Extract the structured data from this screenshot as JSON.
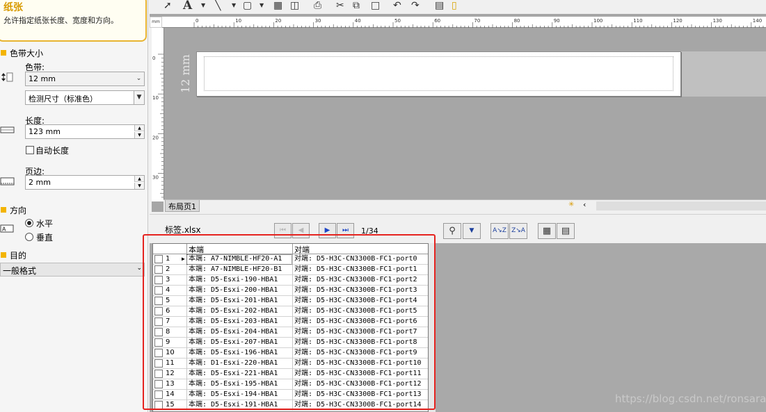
{
  "tip": {
    "title": "纸张",
    "text": "允许指定纸张长度、宽度和方向。"
  },
  "tape_section": {
    "title": "色带大小",
    "tape_label": "色带:",
    "tape_value": "12 mm",
    "detect_value": "检测尺寸（标准色）",
    "length_label": "长度:",
    "length_value": "123 mm",
    "auto_length_label": "自动长度",
    "auto_length_checked": false,
    "margin_label": "页边:",
    "margin_value": "2 mm"
  },
  "orientation_section": {
    "title": "方向",
    "horizontal_label": "水平",
    "vertical_label": "垂直",
    "selected": "水平"
  },
  "purpose_section": {
    "title": "目的",
    "value": "一般格式"
  },
  "ruler": {
    "unit": "mm",
    "top_ticks": [
      "0",
      "10",
      "20",
      "30",
      "40",
      "50",
      "60",
      "70",
      "80",
      "90",
      "100",
      "110",
      "120",
      "130",
      "140"
    ],
    "left_ticks": [
      "0",
      "10",
      "20",
      "30"
    ]
  },
  "canvas": {
    "tape_size_text": "12 mm",
    "page_tab": "布局页1"
  },
  "database": {
    "file_name": "标签.xlsx",
    "record_indicator": "1/34",
    "columns": [
      "本端",
      "对端"
    ],
    "rows": [
      {
        "n": "1",
        "a": "本端: A7-NIMBLE-HF20-A1",
        "b": "对端: D5-H3C-CN3300B-FC1-port0"
      },
      {
        "n": "2",
        "a": "本端: A7-NIMBLE-HF20-B1",
        "b": "对端: D5-H3C-CN3300B-FC1-port1"
      },
      {
        "n": "3",
        "a": "本端: D5-Esxi-190-HBA1",
        "b": "对端: D5-H3C-CN3300B-FC1-port2"
      },
      {
        "n": "4",
        "a": "本端: D5-Esxi-200-HBA1",
        "b": "对端: D5-H3C-CN3300B-FC1-port3"
      },
      {
        "n": "5",
        "a": "本端: D5-Esxi-201-HBA1",
        "b": "对端: D5-H3C-CN3300B-FC1-port4"
      },
      {
        "n": "6",
        "a": "本端: D5-Esxi-202-HBA1",
        "b": "对端: D5-H3C-CN3300B-FC1-port5"
      },
      {
        "n": "7",
        "a": "本端: D5-Esxi-203-HBA1",
        "b": "对端: D5-H3C-CN3300B-FC1-port6"
      },
      {
        "n": "8",
        "a": "本端: D5-Esxi-204-HBA1",
        "b": "对端: D5-H3C-CN3300B-FC1-port7"
      },
      {
        "n": "9",
        "a": "本端: D5-Esxi-207-HBA1",
        "b": "对端: D5-H3C-CN3300B-FC1-port8"
      },
      {
        "n": "10",
        "a": "本端: D5-Esxi-196-HBA1",
        "b": "对端: D5-H3C-CN3300B-FC1-port9"
      },
      {
        "n": "11",
        "a": "本端: D1-Esxi-220-HBA1",
        "b": "对端: D5-H3C-CN3300B-FC1-port10"
      },
      {
        "n": "12",
        "a": "本端: D5-Esxi-221-HBA1",
        "b": "对端: D5-H3C-CN3300B-FC1-port11"
      },
      {
        "n": "13",
        "a": "本端: D5-Esxi-195-HBA1",
        "b": "对端: D5-H3C-CN3300B-FC1-port12"
      },
      {
        "n": "14",
        "a": "本端: D5-Esxi-194-HBA1",
        "b": "对端: D5-H3C-CN3300B-FC1-port13"
      },
      {
        "n": "15",
        "a": "本端: D5-Esxi-191-HBA1",
        "b": "对端: D5-H3C-CN3300B-FC1-port14"
      }
    ],
    "selected_row": "1"
  },
  "watermark": "https://blog.csdn.net/ronsarah",
  "colors": {
    "accent": "#f3b400",
    "highlight_box": "#e5231f"
  }
}
